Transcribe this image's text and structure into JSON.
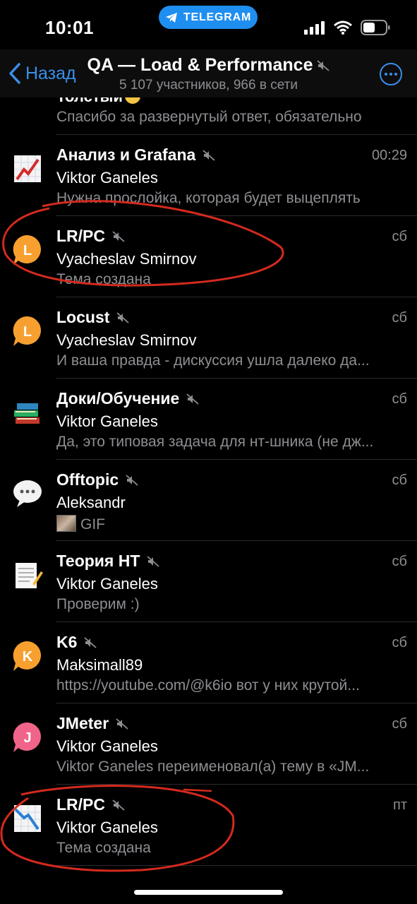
{
  "status_bar": {
    "time": "10:01",
    "pill_label": "TELEGRAM",
    "accent": "#1f8ef1"
  },
  "nav": {
    "back_label": "Назад",
    "title": "QA — Load & Performance",
    "subtitle": "5 107 участников, 966 в сети",
    "accent": "#3a8fea",
    "more_icon": "more-circle-icon"
  },
  "partial_item": {
    "title": "Толстый",
    "message": "Спасибо за развернутый ответ, обязательно"
  },
  "topics": [
    {
      "title": "Анализ и Grafana",
      "time": "00:29",
      "sender": "Viktor Ganeles",
      "message": "Нужна прослойка, которая будет выцеплять",
      "icon": "chart-icon",
      "muted": true
    },
    {
      "title": "LR/PC",
      "time": "сб",
      "sender": "Vyacheslav Smirnov",
      "message": "Тема создана",
      "icon": "letter-bubble-icon",
      "letter": "L",
      "color": "#f7a030",
      "muted": true
    },
    {
      "title": "Locust",
      "time": "сб",
      "sender": "Vyacheslav Smirnov",
      "message": "И ваша правда - дискуссия ушла далеко да...",
      "icon": "letter-bubble-icon",
      "letter": "L",
      "color": "#f7a030",
      "muted": true
    },
    {
      "title": "Доки/Обучение",
      "time": "сб",
      "sender": "Viktor Ganeles",
      "message": "Да, это типовая задача для нт-шника (не дж...",
      "icon": "books-icon",
      "muted": true
    },
    {
      "title": "Offtopic",
      "time": "сб",
      "sender": "Aleksandr",
      "message": "GIF",
      "icon": "speech-bubble-icon",
      "muted": true,
      "thumb": true
    },
    {
      "title": "Теория НТ",
      "time": "сб",
      "sender": "Viktor Ganeles",
      "message": "Проверим :)",
      "icon": "memo-icon",
      "muted": true
    },
    {
      "title": "K6",
      "time": "сб",
      "sender": "Maksimall89",
      "message": "https://youtube.com/@k6io вот у них крутой...",
      "icon": "letter-bubble-icon",
      "letter": "K",
      "color": "#f7a030",
      "muted": true
    },
    {
      "title": "JMeter",
      "time": "сб",
      "sender": "Viktor Ganeles",
      "message": "Viktor Ganeles переименовал(а) тему в «JM...",
      "icon": "letter-bubble-icon",
      "letter": "J",
      "color": "#f0648a",
      "muted": true
    },
    {
      "title": "LR/PC",
      "time": "пт",
      "sender": "Viktor Ganeles",
      "message": "Тема создана",
      "icon": "chart-down-icon",
      "muted": true
    }
  ],
  "annotations": {
    "color": "#d42a1e"
  }
}
